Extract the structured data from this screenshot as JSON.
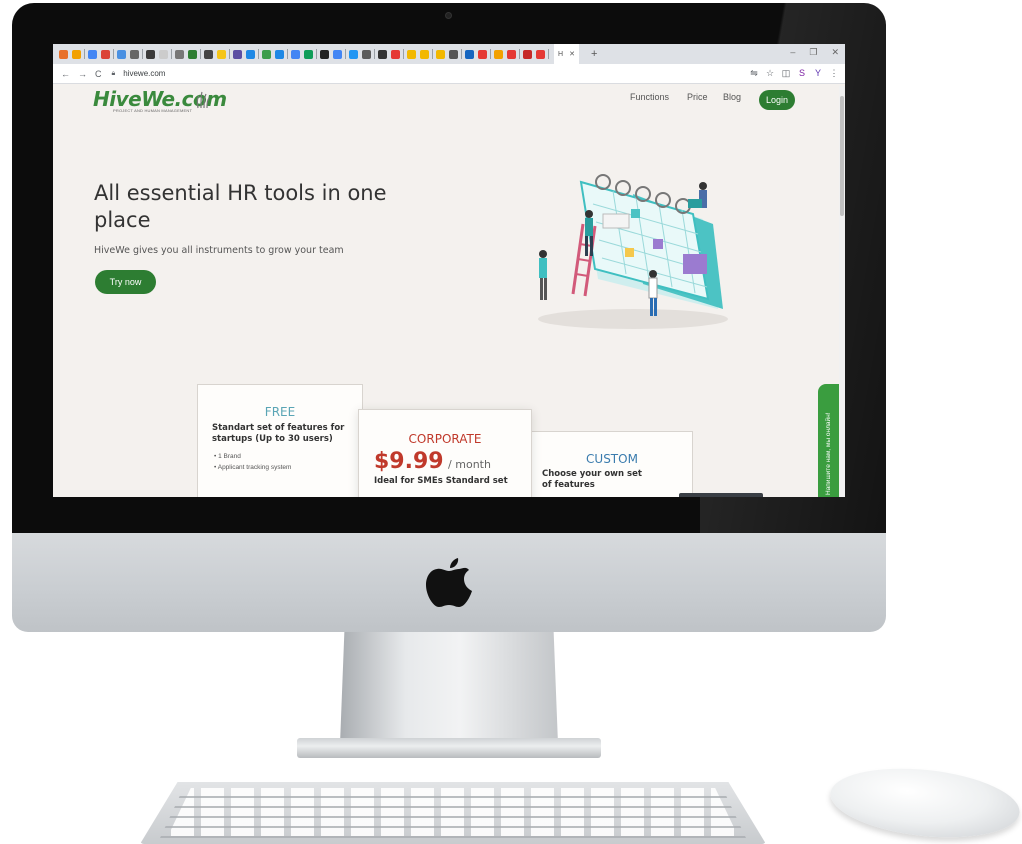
{
  "browser": {
    "active_tab_label": "H",
    "new_tab_symbol": "+",
    "window_controls": [
      "–",
      "❐",
      "✕"
    ],
    "url": "hivewe.com",
    "nav": {
      "back": "←",
      "forward": "→",
      "reload": "C"
    },
    "tab_favicon_colors": [
      "#e8702a",
      "#f2a100",
      "#4285f4",
      "#db4437",
      "#4a90e2",
      "#666666",
      "#3b3b3b",
      "#cccccc",
      "#777777",
      "#2e7d32",
      "#444444",
      "#f5c518",
      "#5b4ea3",
      "#1e88e5",
      "#3c9d4b",
      "#1e88e5",
      "#4285f4",
      "#0f9d58",
      "#222222",
      "#4285f4",
      "#2196f3",
      "#5c5c5c",
      "#333333",
      "#e53935",
      "#f2b800",
      "#f2b800",
      "#f2b800",
      "#555555",
      "#1565c0",
      "#e53935",
      "#f2a100",
      "#e53935",
      "#c62828",
      "#e53935"
    ],
    "extension_icons": [
      {
        "name": "translate-icon",
        "symbol": "⇋",
        "color": "#5f6368"
      },
      {
        "name": "star-icon",
        "symbol": "☆",
        "color": "#5f6368"
      },
      {
        "name": "shield-extension-icon",
        "symbol": "◫",
        "color": "#5f6368"
      },
      {
        "name": "s-extension-icon",
        "symbol": "S",
        "color": "#7b1fa2"
      },
      {
        "name": "profile-avatar-icon",
        "symbol": "Y",
        "color": "#5e35b1"
      },
      {
        "name": "menu-kebab-icon",
        "symbol": "⋮",
        "color": "#5f6368"
      }
    ]
  },
  "site": {
    "logo": "HiveWe.com",
    "logo_tagline": "PROJECT AND HUMAN MANAGEMENT",
    "menu": [
      "Functions",
      "Price",
      "Blog"
    ],
    "login_label": "Login",
    "hero": {
      "title": "All essential HR tools in one place",
      "subtitle": "HiveWe gives you all instruments to grow your team",
      "cta_label": "Try now"
    },
    "plans": {
      "free": {
        "title": "FREE",
        "description": "Standart set of features for startups (Up to 30 users)",
        "features": [
          "1 Brand",
          "Applicant tracking system"
        ]
      },
      "corporate": {
        "title": "CORPORATE",
        "price": "$9.99",
        "period": "/ month",
        "description": "Ideal for SMEs Standard set"
      },
      "custom": {
        "title": "CUSTOM",
        "description": "Choose your own set of features"
      }
    },
    "chat_widget_label": "Напишите нам, мы онлайн!"
  },
  "colors": {
    "brand_green": "#2d7d32",
    "free_title": "#5aa5b5",
    "corporate_title": "#c0392b",
    "custom_title": "#3b7cae",
    "page_bg": "#f4f1ee",
    "illustration_teal": "#3fbfc1"
  }
}
